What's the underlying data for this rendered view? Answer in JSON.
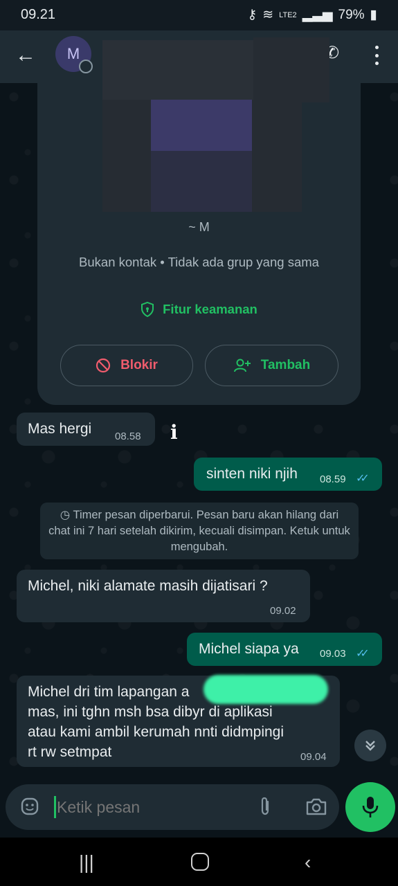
{
  "status_bar": {
    "time": "09.21",
    "battery": "79%",
    "network": "LTE2"
  },
  "header": {
    "avatar_initial": "M"
  },
  "profile_card": {
    "name": "~ M",
    "info": "Bukan kontak • Tidak ada grup yang sama",
    "security_label": "Fitur keamanan",
    "block_label": "Blokir",
    "add_label": "Tambah"
  },
  "messages": [
    {
      "dir": "in",
      "text": "Mas hergi",
      "time": "08.58"
    },
    {
      "dir": "out",
      "text": "sinten niki njih",
      "time": "08.59",
      "read": true
    },
    {
      "dir": "system",
      "text": "Timer pesan diperbarui. Pesan baru akan hilang dari chat ini 7 hari setelah dikirim, kecuali disimpan. Ketuk untuk mengubah."
    },
    {
      "dir": "in",
      "text": "Michel, niki alamate masih dijatisari ?",
      "time": "09.02"
    },
    {
      "dir": "out",
      "text": "Michel siapa ya",
      "time": "09.03",
      "read": true
    },
    {
      "dir": "in",
      "lines": [
        "Michel dri tim lapangan a",
        "mas, ini tghn msh bsa dibyr di aplikasi",
        "atau kami ambil kerumah nnti didmpingi",
        "rt rw setmpat"
      ],
      "time": "09.04"
    }
  ],
  "composer": {
    "placeholder": "Ketik pesan"
  },
  "colors": {
    "accent": "#21c063",
    "outgoing_bubble": "#005c4b",
    "incoming_bubble": "#1f2c34",
    "block_red": "#f15c6d",
    "read_ticks": "#53bdeb"
  }
}
